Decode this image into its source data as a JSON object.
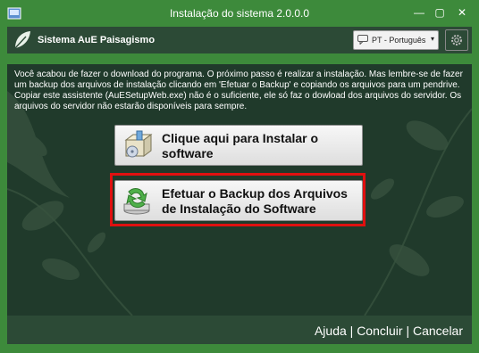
{
  "window": {
    "title": "Instalação do sistema 2.0.0.0",
    "minimize": "—",
    "maximize": "▢",
    "close": "✕"
  },
  "header": {
    "app_name": "Sistema AuE Paisagismo",
    "language": "PT - Português",
    "language_arrow": "▾"
  },
  "content": {
    "message": "Você acabou de fazer o download do programa. O próximo passo é realizar a instalação. Mas lembre-se de fazer um backup dos arquivos de instalação clicando em 'Efetuar o Backup' e copiando os arquivos para um pendrive. Copiar este assistente (AuESetupWeb.exe) não é o suficiente, ele só faz o dowload dos arquivos do servidor. Os arquivos do servidor não estarão disponíveis para sempre.",
    "install_button": "Clique aqui para Instalar o software",
    "backup_button": "Efetuar o Backup dos Arquivos de Instalação do Software"
  },
  "footer": {
    "help": "Ajuda",
    "finish": "Concluir",
    "cancel": "Cancelar",
    "separator": "|"
  },
  "colors": {
    "window_green": "#3d8a3b",
    "panel_dark": "#2c4a36",
    "highlight_red": "#e01010"
  }
}
